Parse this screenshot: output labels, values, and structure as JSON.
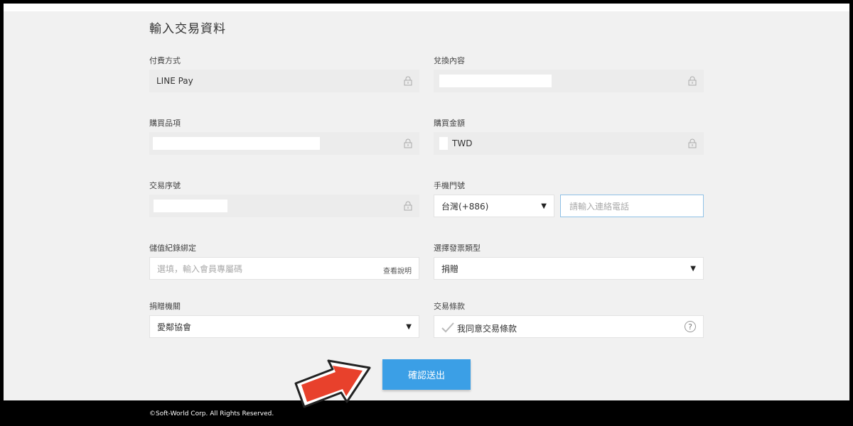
{
  "page": {
    "title": "輸入交易資料"
  },
  "fields": {
    "payment_method": {
      "label": "付費方式",
      "value": "LINE Pay"
    },
    "exchange_content": {
      "label": "兌換內容",
      "value": ""
    },
    "purchase_item": {
      "label": "購買品項",
      "value": ""
    },
    "purchase_amount": {
      "label": "購買金額",
      "currency": "TWD"
    },
    "transaction_no": {
      "label": "交易序號",
      "value": ""
    },
    "phone": {
      "label": "手機門號",
      "country_code": "台灣(+886)",
      "placeholder": "請輸入連絡電話"
    },
    "stored_value_binding": {
      "label": "儲值紀錄綁定",
      "placeholder": "選填，輸入會員專屬碼",
      "help_link": "查看說明"
    },
    "invoice_type": {
      "label": "選擇發票類型",
      "value": "捐贈"
    },
    "donation_org": {
      "label": "捐贈機關",
      "value": "愛鄰協會"
    },
    "terms": {
      "label": "交易條款",
      "checkbox_text": "我同意交易條款",
      "help": "?"
    }
  },
  "submit_label": "確認送出",
  "footer": "©Soft-World Corp. All Rights Reserved.",
  "colors": {
    "accent": "#3b9fe6",
    "arrow": "#e8412c"
  },
  "icons": [
    "lock-icon",
    "chevron-down-icon",
    "check-icon",
    "question-icon",
    "arrow-pointer-icon"
  ]
}
